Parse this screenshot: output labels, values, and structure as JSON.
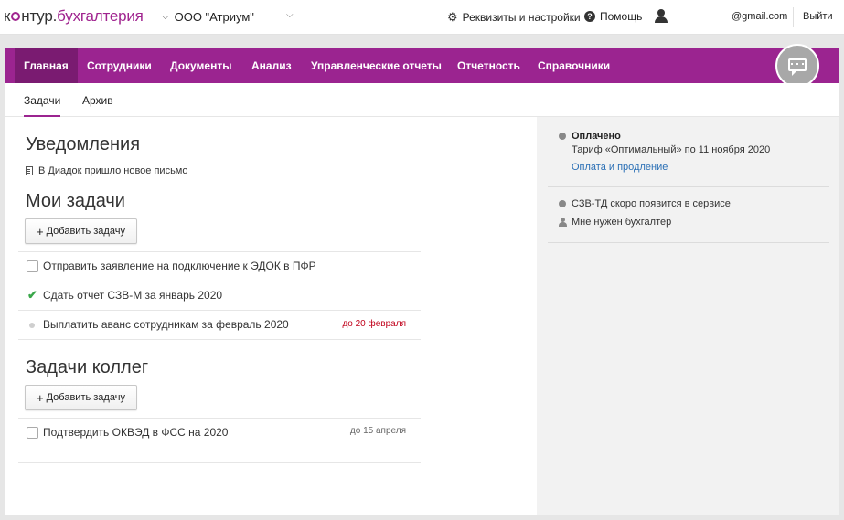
{
  "header": {
    "logo_part1": "к",
    "logo_part2": "нтур.",
    "logo_part3": "бухгалтерия",
    "org_name": "ООО \"Атриум\"",
    "settings_label": "Реквизиты и настройки",
    "help_label": "Помощь",
    "email": "@gmail.com",
    "logout_label": "Выйти"
  },
  "nav": {
    "items": [
      {
        "label": "Главная"
      },
      {
        "label": "Сотрудники"
      },
      {
        "label": "Документы"
      },
      {
        "label": "Анализ"
      },
      {
        "label": "Управленческие отчеты"
      },
      {
        "label": "Отчетность"
      },
      {
        "label": "Справочники"
      }
    ]
  },
  "subtabs": [
    {
      "label": "Задачи"
    },
    {
      "label": "Архив"
    }
  ],
  "notifications": {
    "title": "Уведомления",
    "items": [
      {
        "text": "В Диадок пришло новое письмо"
      }
    ]
  },
  "my_tasks": {
    "title": "Мои задачи",
    "add_label": "Добавить задачу",
    "items": [
      {
        "text": "Отправить заявление на подключение к ЭДОК в ПФР",
        "state": "unchecked",
        "due": ""
      },
      {
        "text": "Сдать отчет СЗВ-М за январь 2020",
        "state": "done",
        "due": ""
      },
      {
        "text": "Выплатить аванс сотрудникам за февраль 2020",
        "state": "dot",
        "due": "до 20 февраля"
      }
    ]
  },
  "colleague_tasks": {
    "title": "Задачи коллег",
    "add_label": "Добавить задачу",
    "items": [
      {
        "text": "Подтвердить ОКВЭД в ФСС на 2020",
        "state": "unchecked",
        "due": "до 15 апреля"
      }
    ]
  },
  "sidebar": {
    "payment_status": "Оплачено",
    "tariff_text": "Тариф «Оптимальный» по 11 ноября 2020",
    "payment_link": "Оплата и продление",
    "szv_td_text": "СЗВ-ТД скоро появится в сервисе",
    "need_accountant_text": "Мне нужен бухгалтер"
  },
  "colors": {
    "brand": "#9b2490",
    "brand_dark": "#7a1b71",
    "link": "#2a6fb5",
    "due_red": "#c0001a",
    "done_green": "#3aa74a"
  }
}
